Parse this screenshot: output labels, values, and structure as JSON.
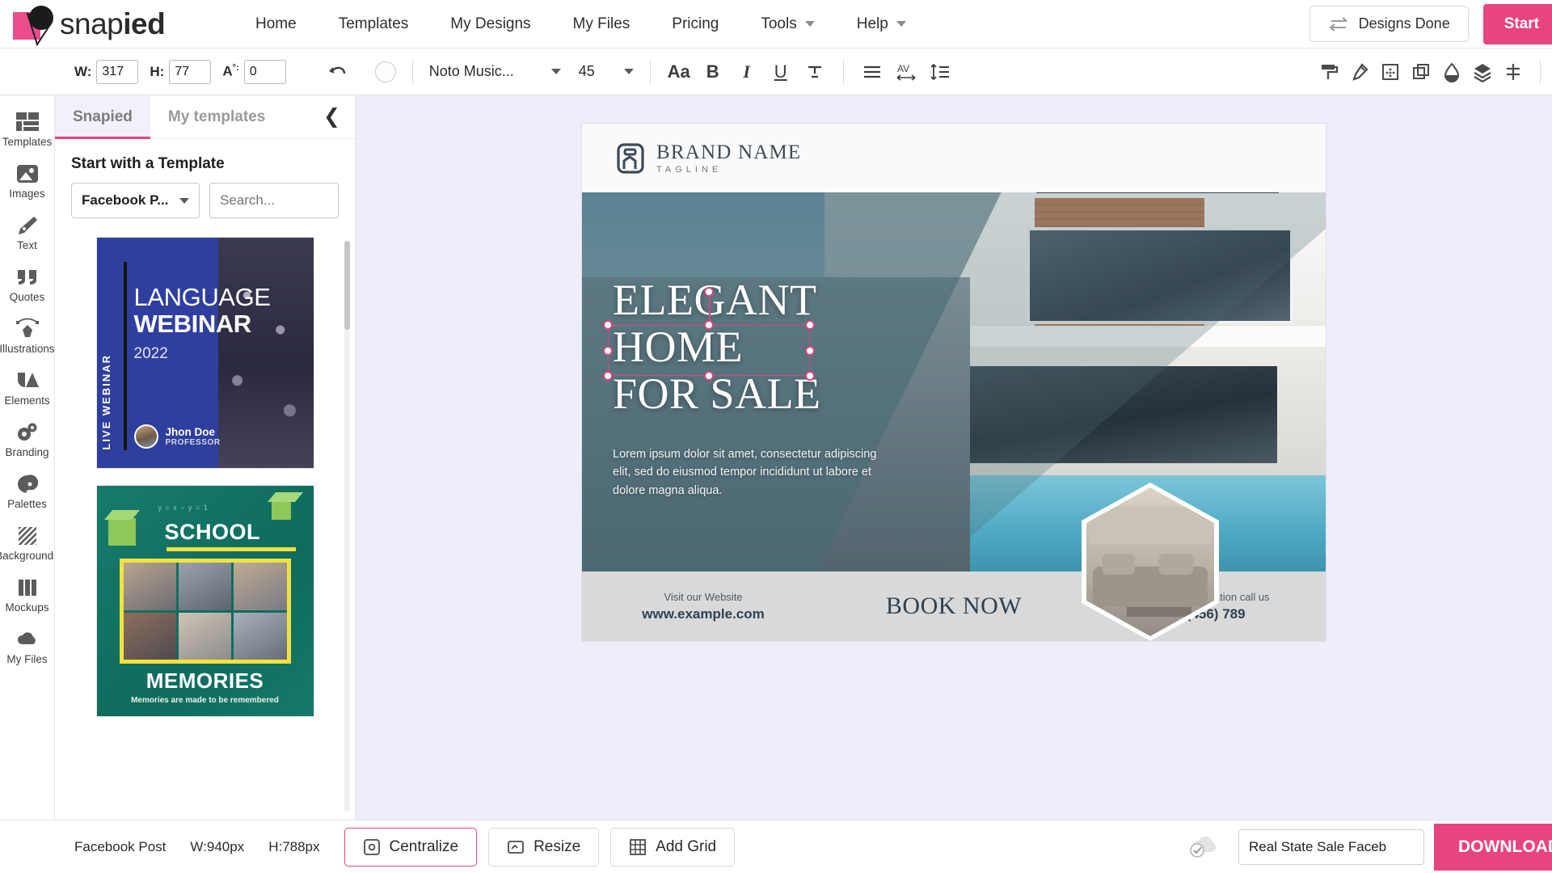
{
  "header": {
    "brand": {
      "name_light": "snap",
      "name_bold": "ied",
      "logo_icon": "snapied-logo-icon"
    },
    "nav": [
      {
        "label": "Home",
        "has_caret": false
      },
      {
        "label": "Templates",
        "has_caret": false
      },
      {
        "label": "My Designs",
        "has_caret": false
      },
      {
        "label": "My Files",
        "has_caret": false
      },
      {
        "label": "Pricing",
        "has_caret": false
      },
      {
        "label": "Tools",
        "has_caret": true
      },
      {
        "label": "Help",
        "has_caret": true
      }
    ],
    "designs_done_label": "Designs Done",
    "designs_done_icon": "swap-arrows-icon",
    "start_label": "Start"
  },
  "toolbar": {
    "width_label": "W:",
    "width_value": "317",
    "height_label": "H:",
    "height_value": "77",
    "angle_label": "A",
    "angle_degree": "°:",
    "angle_value": "0",
    "undo_icon": "undo-icon",
    "color_swatch": "#fdfdfd",
    "font_family": "Noto Music...",
    "font_size": "45",
    "buttons": [
      {
        "name": "text-case-button",
        "glyph": "Aa"
      },
      {
        "name": "bold-button",
        "glyph": "B"
      },
      {
        "name": "italic-button",
        "glyph": "I"
      },
      {
        "name": "underline-button",
        "glyph": "U"
      },
      {
        "name": "strikethrough-button",
        "glyph": "T"
      },
      {
        "name": "align-button",
        "glyph": "≡"
      },
      {
        "name": "letter-spacing-button",
        "glyph": "AV"
      },
      {
        "name": "line-height-button",
        "glyph": "≣"
      }
    ],
    "right_tools": [
      "paint-roller-icon",
      "eyedropper-icon",
      "crop-icon",
      "duplicate-icon",
      "opacity-droplet-icon",
      "layers-icon",
      "align-center-icon"
    ]
  },
  "sidebar": {
    "items": [
      {
        "label": "Templates",
        "icon": "templates-grid-icon"
      },
      {
        "label": "Images",
        "icon": "image-icon"
      },
      {
        "label": "Text",
        "icon": "pen-nib-icon"
      },
      {
        "label": "Quotes",
        "icon": "quote-marks-icon"
      },
      {
        "label": "Illustrations",
        "icon": "bezier-pen-icon"
      },
      {
        "label": "Elements",
        "icon": "shapes-icon"
      },
      {
        "label": "Branding",
        "icon": "gears-icon"
      },
      {
        "label": "Palettes",
        "icon": "palette-icon"
      },
      {
        "label": "Backgrounds",
        "icon": "hatch-pattern-icon"
      },
      {
        "label": "Mockups",
        "icon": "columns-icon"
      },
      {
        "label": "My Files",
        "icon": "cloud-icon"
      }
    ]
  },
  "panel": {
    "tabs": [
      {
        "label": "Snapied",
        "active": true
      },
      {
        "label": "My templates",
        "active": false
      }
    ],
    "collapse_icon": "chevron-left-icon",
    "title": "Start with a Template",
    "category_value": "Facebook P...",
    "search_placeholder": "Search...",
    "templates": [
      {
        "name": "language-webinar-template",
        "vertical_label": "LIVE WEBINAR",
        "title_line1": "LANGUAGE",
        "title_line2": "WEBINAR",
        "year": "2022",
        "author_name": "Jhon Doe",
        "author_role": "PROFESSOR"
      },
      {
        "name": "school-memories-template",
        "equation": "y = x − y = 1",
        "title": "SCHOOL",
        "footer_title": "MEMORIES",
        "footer_sub": "Memories are made to be remembered"
      }
    ]
  },
  "canvas": {
    "design": {
      "brand_name": "BRAND NAME",
      "brand_tagline": "TAGLINE",
      "brand_icon": "house-logo-icon",
      "headline_line1": "ELEGANT",
      "headline_line2": "HOME",
      "headline_line3": "FOR SALE",
      "body_text": "Lorem ipsum dolor sit amet, consectetur adipiscing elit, sed do eiusmod tempor incididunt ut labore et dolore magna aliqua.",
      "footer": {
        "website_label": "Visit our Website",
        "website_value": "www.example.com",
        "cta": "BOOK NOW",
        "phone_label": "For more information call us",
        "phone_value": "123(456) 789"
      }
    },
    "selection": {
      "accent_color": "#d0477f",
      "target": "HOME"
    }
  },
  "bottombar": {
    "doc_type": "Facebook Post",
    "width_label": "W:940px",
    "height_label": "H:788px",
    "buttons": [
      {
        "label": "Centralize",
        "icon": "centralize-icon",
        "accent": true
      },
      {
        "label": "Resize",
        "icon": "resize-icon",
        "accent": false
      },
      {
        "label": "Add Grid",
        "icon": "grid-icon",
        "accent": false
      }
    ],
    "save_status_icon": "cloud-check-icon",
    "design_name": "Real State Sale Faceb",
    "download_label": "DOWNLOAD"
  },
  "colors": {
    "accent": "#e8447f",
    "canvas_bg": "#f0edfb",
    "panel_active": "#f4f0fb"
  }
}
